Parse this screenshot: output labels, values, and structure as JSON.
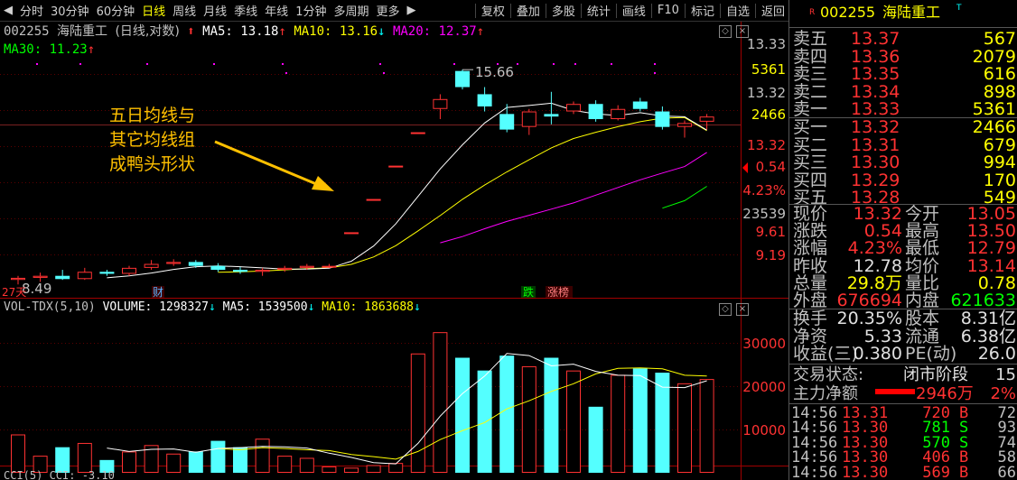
{
  "toolbar": {
    "left": [
      "分时",
      "30分钟",
      "60分钟",
      "日线",
      "周线",
      "月线",
      "季线",
      "年线",
      "1分钟",
      "多周期",
      "更多"
    ],
    "active": "日线",
    "more_arrow": "▶",
    "right": [
      "复权",
      "叠加",
      "多股",
      "统计",
      "画线",
      "F10",
      "标记",
      "自选",
      "返回"
    ]
  },
  "chart": {
    "header": {
      "code": "002255",
      "name": "海陆重工",
      "mode": "(日线,对数)",
      "ma5_label": "MA5:",
      "ma5": "13.18",
      "ma10_label": "MA10:",
      "ma10": "13.16",
      "ma20_label": "MA20:",
      "ma20": "12.37",
      "ma30_label": "MA30:",
      "ma30": "11.23"
    },
    "annotation": "五日均线与\n其它均线组\n成鸭头形状",
    "annotation_lines": [
      "五日均线与",
      "其它均线组",
      "成鸭头形状"
    ],
    "high_label": "15.66",
    "low_label": "8.49",
    "marker_27": "27天",
    "marker_cai": "财",
    "marker_die": "跌",
    "marker_zhangbang": "涨榜",
    "right_axis": [
      "13.33",
      "5361",
      "13.32",
      "2466",
      "13.32",
      "0.54",
      "4.23%",
      "23539",
      "9.61",
      "9.19"
    ],
    "volume_header": {
      "name": "VOL-TDX(5,10)",
      "vol_label": "VOLUME:",
      "vol": "1298327",
      "ma5_label": "MA5:",
      "ma5": "1539500",
      "ma10_label": "MA10:",
      "ma10": "1863688"
    },
    "volume_axis": [
      "30000",
      "20000",
      "10000"
    ],
    "cci_header": "CCI(5) CCI: -3.10",
    "colors": {
      "up": "#ff3232",
      "down": "#54ffff",
      "ma5": "#ffffff",
      "ma10": "#ffff00",
      "ma20": "#ff00ff",
      "ma30": "#00ff00"
    }
  },
  "chart_data": {
    "type": "candlestick",
    "scale": "log",
    "candles": [
      {
        "o": 8.6,
        "h": 8.7,
        "l": 8.49,
        "c": 8.65
      },
      {
        "o": 8.65,
        "h": 8.78,
        "l": 8.55,
        "c": 8.7
      },
      {
        "o": 8.7,
        "h": 8.85,
        "l": 8.6,
        "c": 8.62
      },
      {
        "o": 8.62,
        "h": 8.9,
        "l": 8.6,
        "c": 8.8
      },
      {
        "o": 8.8,
        "h": 8.85,
        "l": 8.7,
        "c": 8.75
      },
      {
        "o": 8.75,
        "h": 8.95,
        "l": 8.7,
        "c": 8.9
      },
      {
        "o": 8.9,
        "h": 9.1,
        "l": 8.85,
        "c": 9.0
      },
      {
        "o": 9.0,
        "h": 9.12,
        "l": 8.95,
        "c": 9.05
      },
      {
        "o": 9.05,
        "h": 9.1,
        "l": 8.9,
        "c": 8.95
      },
      {
        "o": 8.95,
        "h": 9.02,
        "l": 8.8,
        "c": 8.85
      },
      {
        "o": 8.85,
        "h": 8.92,
        "l": 8.75,
        "c": 8.8
      },
      {
        "o": 8.8,
        "h": 8.9,
        "l": 8.7,
        "c": 8.85
      },
      {
        "o": 8.85,
        "h": 8.95,
        "l": 8.8,
        "c": 8.9
      },
      {
        "o": 8.9,
        "h": 9.0,
        "l": 8.85,
        "c": 8.95
      },
      {
        "o": 8.95,
        "h": 9.0,
        "l": 8.9,
        "c": 8.95
      },
      {
        "o": 9.85,
        "h": 9.85,
        "l": 9.85,
        "c": 9.85
      },
      {
        "o": 10.83,
        "h": 10.83,
        "l": 10.83,
        "c": 10.83
      },
      {
        "o": 11.91,
        "h": 11.91,
        "l": 11.91,
        "c": 11.91
      },
      {
        "o": 13.1,
        "h": 13.1,
        "l": 13.1,
        "c": 13.1
      },
      {
        "o": 14.0,
        "h": 14.6,
        "l": 13.6,
        "c": 14.4
      },
      {
        "o": 15.6,
        "h": 15.66,
        "l": 14.8,
        "c": 14.9
      },
      {
        "o": 14.6,
        "h": 14.9,
        "l": 13.9,
        "c": 14.1
      },
      {
        "o": 13.8,
        "h": 14.2,
        "l": 13.1,
        "c": 13.2
      },
      {
        "o": 13.3,
        "h": 14.0,
        "l": 13.0,
        "c": 13.9
      },
      {
        "o": 13.8,
        "h": 14.7,
        "l": 13.4,
        "c": 13.7
      },
      {
        "o": 13.9,
        "h": 14.3,
        "l": 13.8,
        "c": 14.2
      },
      {
        "o": 14.2,
        "h": 14.35,
        "l": 13.5,
        "c": 13.6
      },
      {
        "o": 13.6,
        "h": 14.15,
        "l": 13.55,
        "c": 14.0
      },
      {
        "o": 14.3,
        "h": 14.45,
        "l": 13.9,
        "c": 14.0
      },
      {
        "o": 13.9,
        "h": 14.1,
        "l": 13.2,
        "c": 13.3
      },
      {
        "o": 13.3,
        "h": 13.55,
        "l": 12.9,
        "c": 13.45
      },
      {
        "o": 13.5,
        "h": 13.8,
        "l": 13.2,
        "c": 13.7
      }
    ],
    "volume": [
      9000,
      4000,
      6000,
      7000,
      3000,
      5000,
      6500,
      4500,
      5000,
      7500,
      6000,
      8000,
      4000,
      3500,
      1500,
      1200,
      1800,
      2300,
      28000,
      33000,
      27000,
      24000,
      27500,
      25000,
      27000,
      24000,
      15500,
      23000,
      24500,
      23500,
      21000,
      22000
    ],
    "vol_ma5": [
      null,
      null,
      null,
      null,
      5800,
      5000,
      5500,
      5600,
      4800,
      5700,
      5900,
      6200,
      6100,
      5800,
      4600,
      3600,
      2400,
      2100,
      6900,
      13300,
      18600,
      22700,
      28000,
      27500,
      25100,
      25500,
      23800,
      22900,
      22800,
      20100,
      20000,
      21600
    ],
    "vol_ma10": [
      null,
      null,
      null,
      null,
      null,
      null,
      null,
      null,
      null,
      5700,
      5400,
      5900,
      5700,
      5400,
      5200,
      4300,
      3800,
      3200,
      5000,
      7800,
      9900,
      11800,
      15000,
      16900,
      19100,
      20900,
      23200,
      24500,
      24600,
      24400,
      22900,
      22700
    ],
    "ma5": [
      null,
      null,
      null,
      null,
      8.65,
      8.7,
      8.77,
      8.86,
      8.93,
      8.95,
      8.93,
      8.9,
      8.87,
      8.87,
      8.89,
      9.07,
      9.47,
      10.09,
      10.91,
      11.8,
      12.64,
      13.45,
      14.06,
      14.14,
      14.23,
      13.94,
      13.8,
      13.74,
      13.85,
      13.72,
      13.69,
      13.18
    ],
    "ma10": [
      null,
      null,
      null,
      null,
      null,
      null,
      null,
      null,
      null,
      8.79,
      8.8,
      8.82,
      8.85,
      8.88,
      8.9,
      8.99,
      9.18,
      9.48,
      9.89,
      10.33,
      10.82,
      11.27,
      11.7,
      12.11,
      12.53,
      12.87,
      13.1,
      13.31,
      13.5,
      13.64,
      13.66,
      13.16
    ],
    "ma20": [
      null,
      null,
      null,
      null,
      null,
      null,
      null,
      null,
      null,
      null,
      null,
      null,
      null,
      null,
      null,
      null,
      null,
      null,
      null,
      9.56,
      9.73,
      9.95,
      10.16,
      10.34,
      10.52,
      10.71,
      10.95,
      11.19,
      11.44,
      11.66,
      11.88,
      12.37
    ],
    "ma30": [
      null,
      null,
      null,
      null,
      null,
      null,
      null,
      null,
      null,
      null,
      null,
      null,
      null,
      null,
      null,
      null,
      null,
      null,
      null,
      null,
      null,
      null,
      null,
      null,
      null,
      null,
      null,
      null,
      null,
      10.55,
      10.78,
      11.23
    ]
  },
  "panel": {
    "code": "002255",
    "name": "海陆重工",
    "sells": [
      {
        "label": "卖五",
        "price": "13.37",
        "vol": "567"
      },
      {
        "label": "卖四",
        "price": "13.36",
        "vol": "2079"
      },
      {
        "label": "卖三",
        "price": "13.35",
        "vol": "616"
      },
      {
        "label": "卖二",
        "price": "13.34",
        "vol": "898"
      },
      {
        "label": "卖一",
        "price": "13.33",
        "vol": "5361"
      }
    ],
    "buys": [
      {
        "label": "买一",
        "price": "13.32",
        "vol": "2466"
      },
      {
        "label": "买二",
        "price": "13.31",
        "vol": "679"
      },
      {
        "label": "买三",
        "price": "13.30",
        "vol": "994"
      },
      {
        "label": "买四",
        "price": "13.29",
        "vol": "170"
      },
      {
        "label": "买五",
        "price": "13.28",
        "vol": "549"
      }
    ],
    "stats": [
      {
        "l1": "现价",
        "v1": "13.32",
        "c1": "red",
        "l2": "今开",
        "v2": "13.05",
        "c2": "red"
      },
      {
        "l1": "涨跌",
        "v1": "0.54",
        "c1": "red",
        "l2": "最高",
        "v2": "13.50",
        "c2": "red"
      },
      {
        "l1": "涨幅",
        "v1": "4.23%",
        "c1": "red",
        "l2": "最低",
        "v2": "12.79",
        "c2": "red"
      },
      {
        "l1": "昨收",
        "v1": "12.78",
        "c1": "white",
        "l2": "均价",
        "v2": "13.14",
        "c2": "red"
      },
      {
        "l1": "总量",
        "v1": "29.8万",
        "c1": "yellow",
        "l2": "量比",
        "v2": "0.78",
        "c2": "yellow"
      },
      {
        "l1": "外盘",
        "v1": "676694",
        "c1": "red",
        "l2": "内盘",
        "v2": "621633",
        "c2": "green"
      }
    ],
    "stats2": [
      {
        "l1": "换手",
        "v1": "20.35%",
        "c1": "white",
        "l2": "股本",
        "v2": "8.31亿",
        "c2": "white"
      },
      {
        "l1": "净资",
        "v1": "5.33",
        "c1": "white",
        "l2": "流通",
        "v2": "6.38亿",
        "c2": "white"
      },
      {
        "l1": "收益(三)",
        "v1": "0.380",
        "c1": "white",
        "l2": "PE(动)",
        "v2": "26.0",
        "c2": "white"
      }
    ],
    "trade_status_label": "交易状态:",
    "trade_status": "闭市阶段",
    "trade_status_num": "15",
    "main_net_label": "主力净额",
    "main_net": "2946万",
    "main_net_pct": "2%",
    "ticks": [
      {
        "time": "14:56",
        "price": "13.31",
        "vol": "720",
        "bs": "B",
        "n": "72"
      },
      {
        "time": "14:56",
        "price": "13.30",
        "vol": "781",
        "bs": "S",
        "n": "93"
      },
      {
        "time": "14:56",
        "price": "13.30",
        "vol": "570",
        "bs": "S",
        "n": "74"
      },
      {
        "time": "14:56",
        "price": "13.30",
        "vol": "406",
        "bs": "B",
        "n": "58"
      },
      {
        "time": "14:56",
        "price": "13.30",
        "vol": "569",
        "bs": "B",
        "n": "66"
      }
    ]
  }
}
